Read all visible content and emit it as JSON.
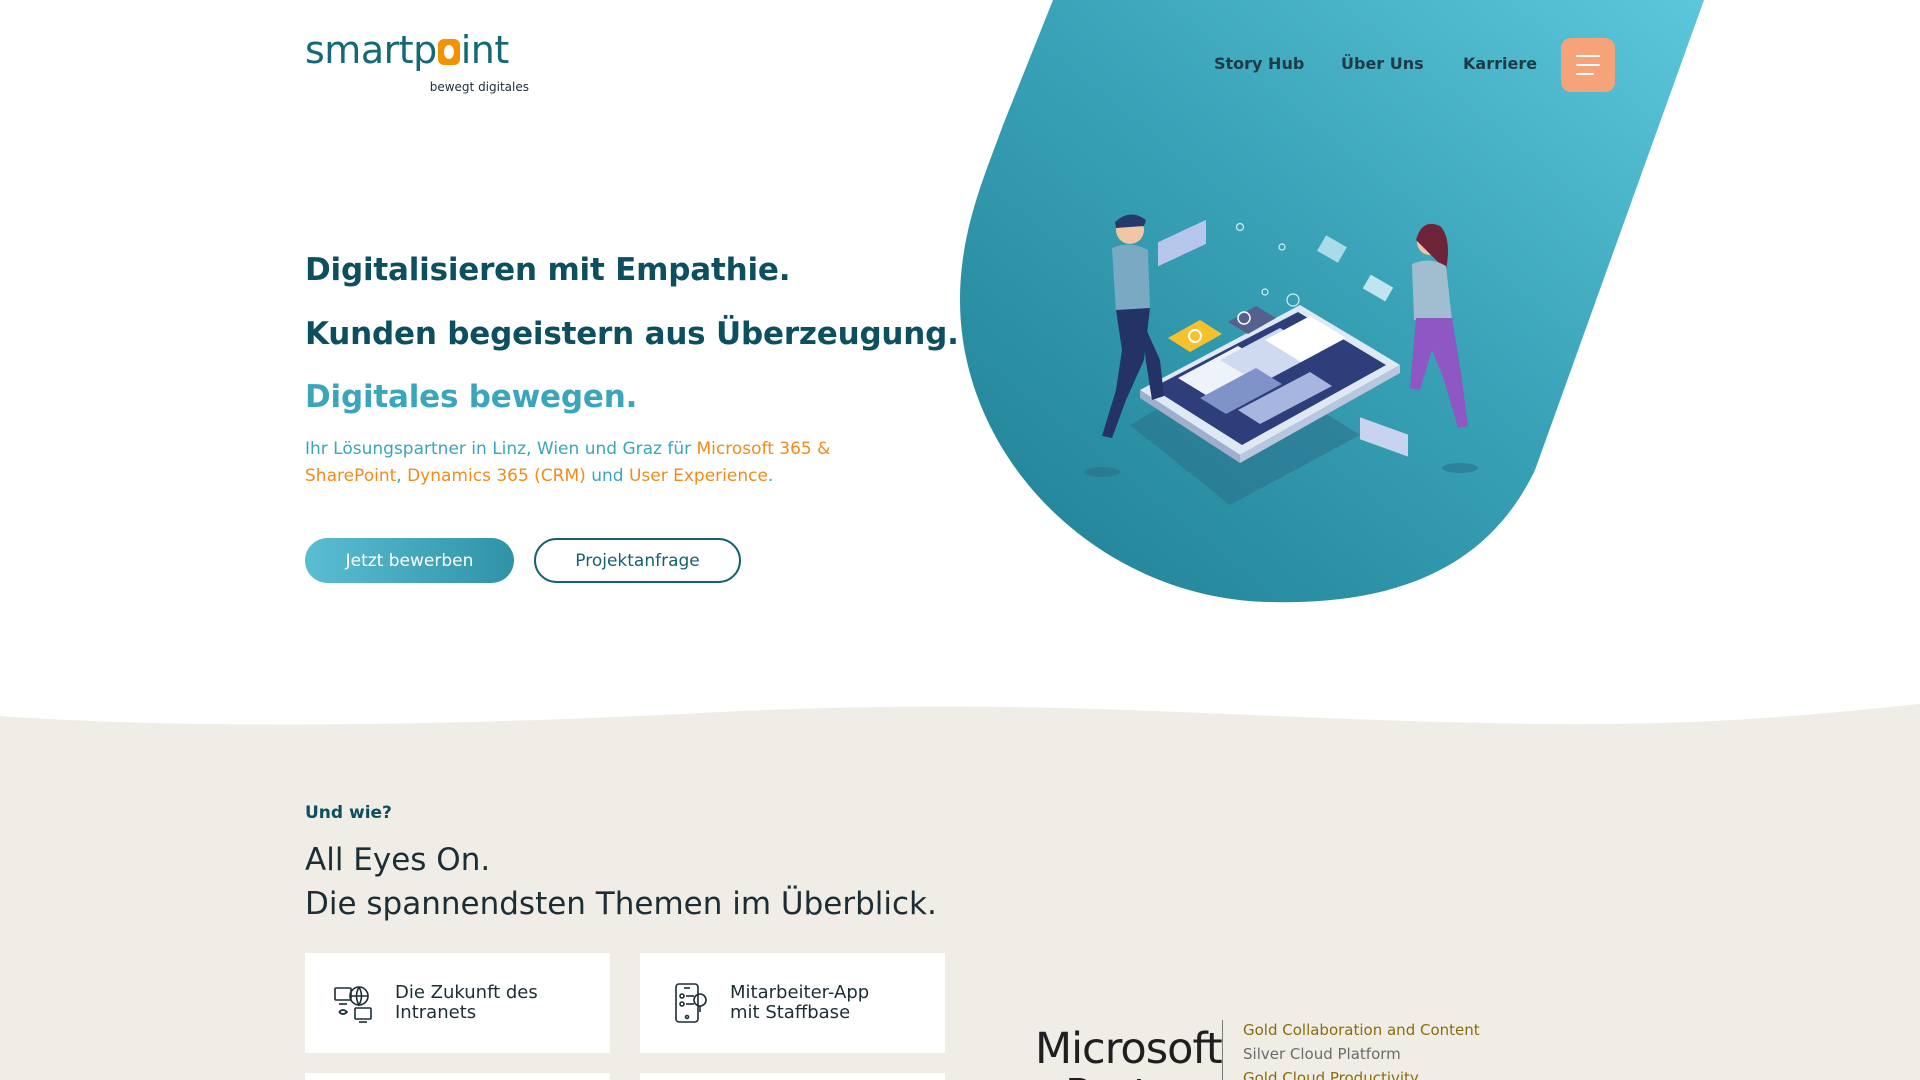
{
  "brand": {
    "logo_prefix": "smartp",
    "logo_suffix": "int",
    "tagline": "bewegt digitales",
    "accent_color": "#f29200",
    "primary_color": "#0c4f5e"
  },
  "nav": {
    "items": [
      {
        "label": "Story Hub"
      },
      {
        "label": "Über Uns"
      },
      {
        "label": "Karriere"
      }
    ],
    "menu_icon": "hamburger-icon"
  },
  "hero": {
    "headline_1": "Digitalisieren mit Empathie.",
    "headline_2": "Kunden begeistern aus Überzeugung.",
    "headline_3": "Digitales bewegen.",
    "sub_1": "Ihr Lösungspartner in Linz, Wien und Graz für ",
    "sub_hl_1": "Microsoft 365 & SharePoint",
    "sub_2": ", ",
    "sub_hl_2": "Dynamics 365 (CRM)",
    "sub_3": " und ",
    "sub_hl_3": "User Experience",
    "sub_4": ".",
    "cta_primary": "Jetzt bewerben",
    "cta_secondary": "Projektanfrage"
  },
  "topics": {
    "eyebrow": "Und wie?",
    "title_line_1": "All Eyes On.",
    "title_line_2": "Die spannendsten Themen im Überblick.",
    "cards": [
      {
        "label": "Die Zukunft des\nIntranets",
        "icon": "intranet-network-icon"
      },
      {
        "label": "Mitarbeiter-App\nmit Staffbase",
        "icon": "mobile-app-icon"
      }
    ]
  },
  "partner": {
    "name": "Microsoft",
    "name_2": "Partner",
    "levels": [
      {
        "text": "Gold Collaboration and Content",
        "tier": "gold"
      },
      {
        "text": "Silver Cloud Platform",
        "tier": "silver"
      },
      {
        "text": "Gold Cloud Productivity",
        "tier": "gold"
      }
    ]
  }
}
